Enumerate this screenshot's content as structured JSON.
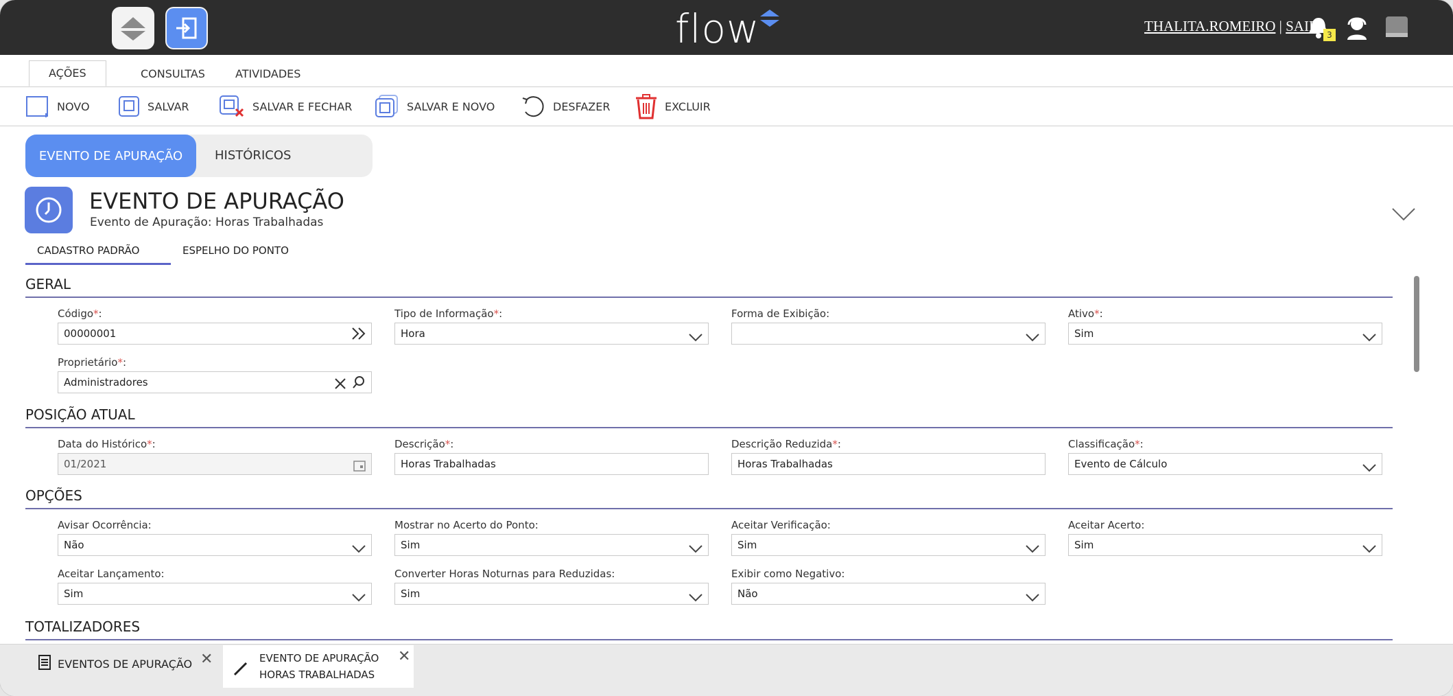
{
  "topbar": {
    "logo": "flow",
    "user": "THALITA.ROMEIRO",
    "separator": "|",
    "logout": "SAIR",
    "notification_count": "3"
  },
  "action_tabs": [
    "AÇÕES",
    "CONSULTAS",
    "ATIVIDADES"
  ],
  "toolbar": {
    "novo": "NOVO",
    "salvar": "SALVAR",
    "salvar_fechar": "SALVAR E FECHAR",
    "salvar_novo": "SALVAR E NOVO",
    "desfazer": "DESFAZER",
    "excluir": "EXCLUIR"
  },
  "page_tabs": {
    "active": "EVENTO DE APURAÇÃO",
    "other": "HISTÓRICOS"
  },
  "header": {
    "title": "EVENTO DE APURAÇÃO",
    "subtitle": "Evento de Apuração: Horas Trabalhadas"
  },
  "sub_tabs": [
    "CADASTRO PADRÃO",
    "ESPELHO DO PONTO"
  ],
  "sections": {
    "geral": "GERAL",
    "posicao": "POSIÇÃO ATUAL",
    "opcoes": "OPÇÕES",
    "totalizadores": "TOTALIZADORES"
  },
  "required_mark": "*",
  "fields": {
    "codigo": {
      "label": "Código",
      "value": "00000001"
    },
    "tipo_info": {
      "label": "Tipo de Informação",
      "value": "Hora"
    },
    "forma_exibicao": {
      "label": "Forma de Exibição",
      "value": ""
    },
    "ativo": {
      "label": "Ativo",
      "value": "Sim"
    },
    "proprietario": {
      "label": "Proprietário",
      "value": "Administradores"
    },
    "data_historico": {
      "label": "Data do Histórico",
      "value": "01/2021"
    },
    "descricao": {
      "label": "Descrição",
      "value": "Horas Trabalhadas"
    },
    "descricao_reduzida": {
      "label": "Descrição Reduzida",
      "value": "Horas Trabalhadas"
    },
    "classificacao": {
      "label": "Classificação",
      "value": "Evento de Cálculo"
    },
    "avisar_ocorrencia": {
      "label": "Avisar Ocorrência:",
      "value": "Não"
    },
    "mostrar_acerto": {
      "label": "Mostrar no Acerto do Ponto:",
      "value": "Sim"
    },
    "aceitar_verificacao": {
      "label": "Aceitar Verificação:",
      "value": "Sim"
    },
    "aceitar_acerto": {
      "label": "Aceitar Acerto:",
      "value": "Sim"
    },
    "aceitar_lancamento": {
      "label": "Aceitar Lançamento:",
      "value": "Sim"
    },
    "converter_horas": {
      "label": "Converter Horas Noturnas para Reduzidas:",
      "value": "Sim"
    },
    "exibir_negativo": {
      "label": "Exibir como Negativo:",
      "value": "Não"
    }
  },
  "bottom_tabs": {
    "tab1": "EVENTOS DE APURAÇÃO",
    "tab2_line1": "EVENTO DE APURAÇÃO",
    "tab2_line2": "HORAS TRABALHADAS"
  },
  "colors": {
    "topbar": "#2d2d2d",
    "accent": "#5b8ef0",
    "section_line": "#6f6faa",
    "required": "#d9534f"
  }
}
